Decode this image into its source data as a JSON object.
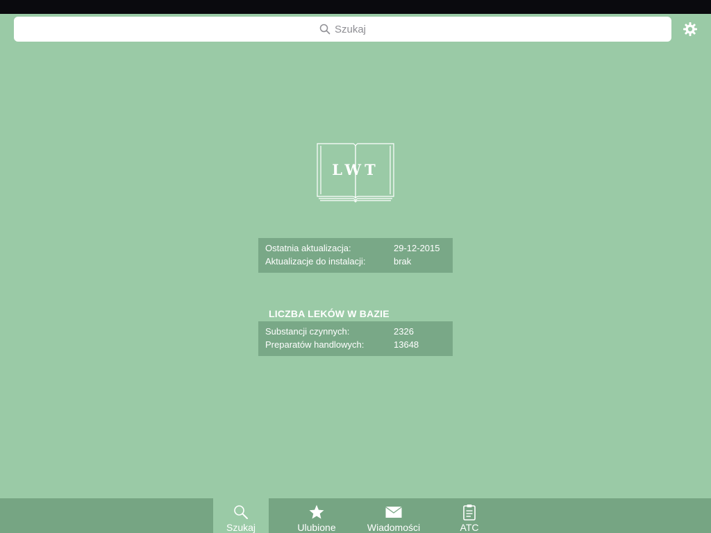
{
  "search": {
    "placeholder": "Szukaj"
  },
  "logo": {
    "text": "LWT"
  },
  "update_info": {
    "rows": [
      {
        "label": "Ostatnia aktualizacja:",
        "value": "29-12-2015"
      },
      {
        "label": "Aktualizacje do instalacji:",
        "value": "brak"
      }
    ]
  },
  "drug_count": {
    "title": "LICZBA LEKÓW W BAZIE",
    "rows": [
      {
        "label": "Substancji czynnych:",
        "value": "2326"
      },
      {
        "label": "Preparatów handlowych:",
        "value": "13648"
      }
    ]
  },
  "tabs": [
    {
      "label": "Szukaj",
      "icon": "search-icon",
      "active": true
    },
    {
      "label": "Ulubione",
      "icon": "star-icon",
      "active": false
    },
    {
      "label": "Wiadomości",
      "icon": "envelope-icon",
      "active": false
    },
    {
      "label": "ATC",
      "icon": "clipboard-icon",
      "active": false
    }
  ],
  "colors": {
    "background": "#9acaa6",
    "panel": "#79a887",
    "tab_bar": "#76a583",
    "status_bar": "#0a0a0e"
  }
}
